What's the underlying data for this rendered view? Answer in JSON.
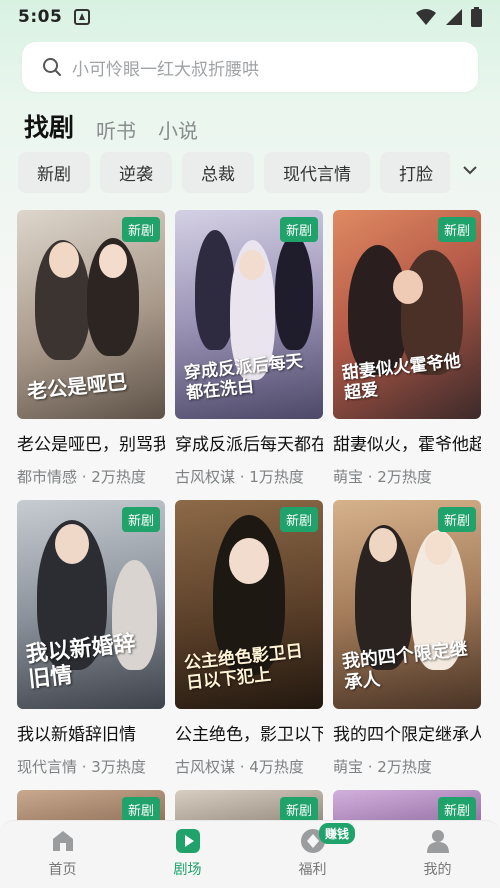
{
  "status": {
    "time": "5:05"
  },
  "search": {
    "placeholder": "小可怜眼一红大叔折腰哄"
  },
  "main_tabs": [
    {
      "label": "找剧",
      "active": true
    },
    {
      "label": "听书",
      "active": false
    },
    {
      "label": "小说",
      "active": false
    }
  ],
  "chips": [
    "新剧",
    "逆袭",
    "总裁",
    "现代言情",
    "打脸"
  ],
  "cards": [
    {
      "title": "老公是哑巴，别骂我是哑巴",
      "meta": "都市情感 · 2万热度",
      "badge": "新剧",
      "poster_text": "老公是哑巴",
      "colors": [
        "#d9d2c8",
        "#7d6f63"
      ]
    },
    {
      "title": "穿成反派后每天都在洗白",
      "meta": "古风权谋 · 1万热度",
      "badge": "新剧",
      "poster_text": "穿成反派后每天都在洗白",
      "colors": [
        "#c9c6d8",
        "#5e5a7a"
      ]
    },
    {
      "title": "甜妻似火，霍爷他超爱",
      "meta": "萌宝 · 2万热度",
      "badge": "新剧",
      "poster_text": "甜妻似火霍爷他超爱",
      "colors": [
        "#d6795a",
        "#3a2a2a"
      ]
    },
    {
      "title": "我以新婚辞旧情",
      "meta": "现代言情 · 3万热度",
      "badge": "新剧",
      "poster_text": "我以新婚辞旧情",
      "colors": [
        "#bcc2c8",
        "#4a4f58"
      ]
    },
    {
      "title": "公主绝色，影卫以下犯上",
      "meta": "古风权谋 · 4万热度",
      "badge": "新剧",
      "poster_text": "公主绝色影卫日日以下犯上",
      "colors": [
        "#7a5638",
        "#2a1d14"
      ]
    },
    {
      "title": "我的四个限定继承人",
      "meta": "萌宝 · 2万热度",
      "badge": "新剧",
      "poster_text": "我的四个限定继承人",
      "colors": [
        "#caa27c",
        "#5a3e2b"
      ]
    },
    {
      "title": "",
      "meta": "",
      "badge": "新剧",
      "poster_text": "",
      "colors": [
        "#b89a82",
        "#8a6c55"
      ]
    },
    {
      "title": "",
      "meta": "",
      "badge": "新剧",
      "poster_text": "",
      "colors": [
        "#cfc4b6",
        "#8d8276"
      ]
    },
    {
      "title": "",
      "meta": "",
      "badge": "新剧",
      "poster_text": "",
      "colors": [
        "#c9a6d4",
        "#8f6aa0"
      ]
    }
  ],
  "bottom_nav": [
    {
      "label": "首页",
      "icon": "home-icon",
      "active": false
    },
    {
      "label": "剧场",
      "icon": "play-icon",
      "active": true
    },
    {
      "label": "福利",
      "icon": "coin-icon",
      "active": false,
      "badge": "赚钱"
    },
    {
      "label": "我的",
      "icon": "profile-icon",
      "active": false
    }
  ],
  "colors": {
    "accent": "#1fa36a",
    "chip_bg": "#ebedec"
  }
}
